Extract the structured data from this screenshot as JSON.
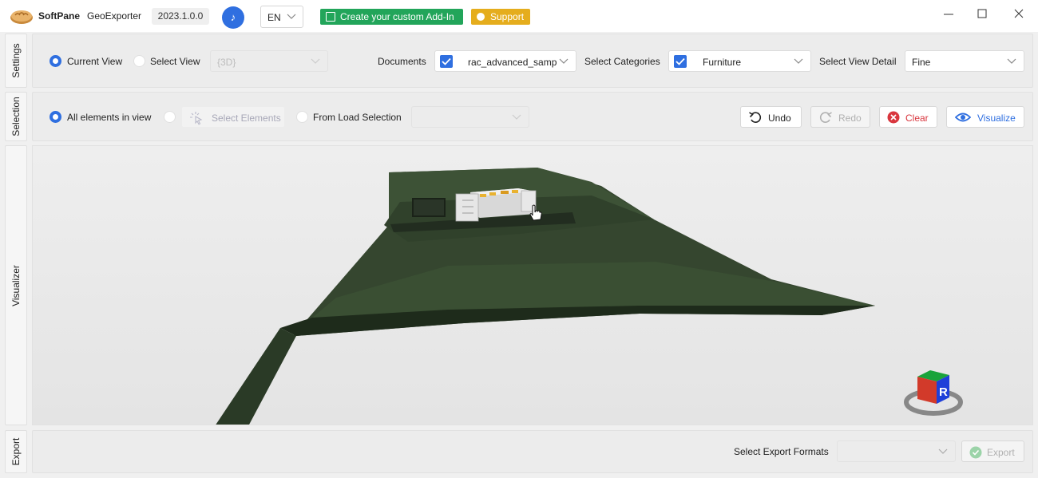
{
  "titlebar": {
    "brand": "SoftPane",
    "product": "GeoExporter",
    "version": "2023.1.0.0",
    "language": "EN",
    "addin_label": "Create your custom Add-In",
    "support_label": "Support",
    "icons": [
      "bread-logo-icon",
      "music-note-icon",
      "chevron-down-icon",
      "calendar-icon",
      "support-icon",
      "minimize-icon",
      "maximize-icon",
      "close-icon"
    ],
    "colors": {
      "accent": "#2f6fe0",
      "addin": "#22a55a",
      "support": "#e5ad1d"
    }
  },
  "side_tabs": [
    "Settings",
    "Selection",
    "Visualizer",
    "Export"
  ],
  "settings": {
    "current_view_label": "Current View",
    "select_view_label": "Select View",
    "select_view_value": "{3D}",
    "documents_label": "Documents",
    "documents_value": "rac_advanced_samp",
    "categories_label": "Select Categories",
    "categories_value": "Furniture",
    "view_detail_label": "Select View Detail",
    "view_detail_value": "Fine"
  },
  "selection": {
    "all_elements_label": "All elements in view",
    "select_elements_label": "Select Elements",
    "from_load_label": "From Load Selection",
    "undo_label": "Undo",
    "redo_label": "Redo",
    "clear_label": "Clear",
    "visualize_label": "Visualize"
  },
  "export": {
    "formats_label": "Select Export Formats",
    "export_label": "Export"
  },
  "viewcube": {
    "face_label": "R"
  }
}
